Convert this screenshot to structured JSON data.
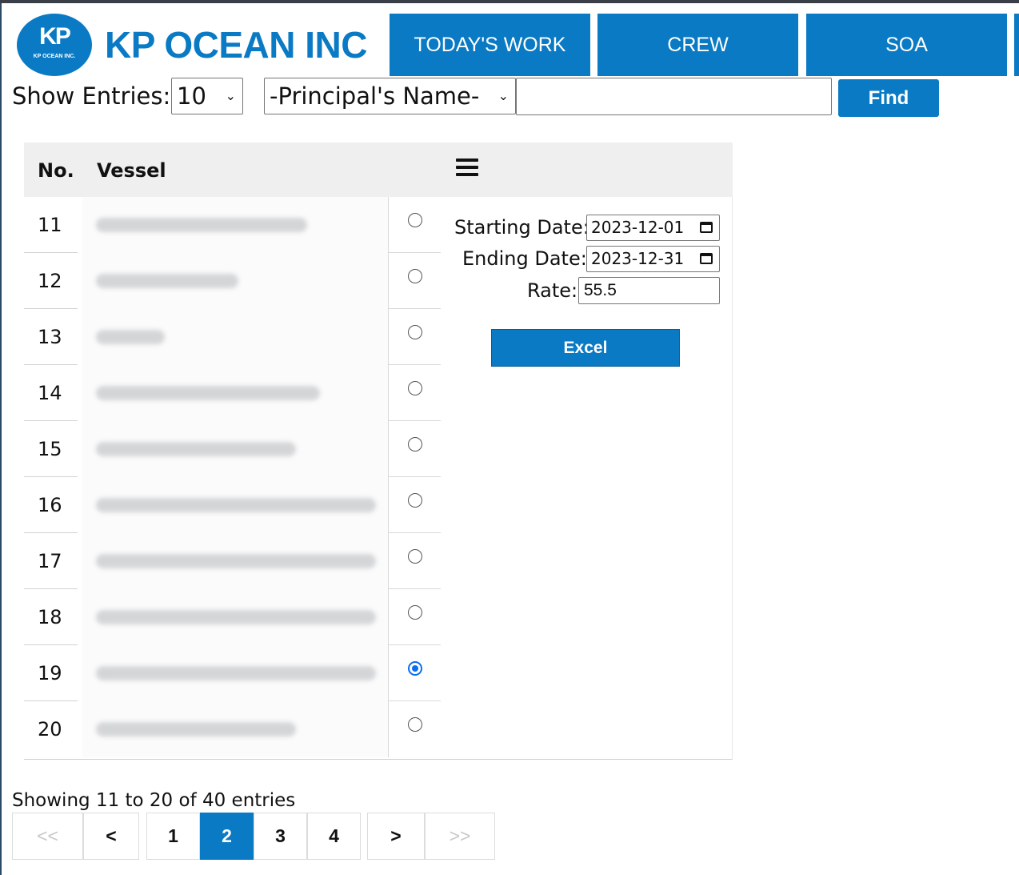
{
  "header": {
    "logo_mark": "KP",
    "logo_subtext": "KP OCEAN INC.",
    "brand": "KP OCEAN INC",
    "nav_tabs": [
      "TODAY'S WORK",
      "CREW",
      "SOA"
    ]
  },
  "filters": {
    "show_entries_label": "Show Entries:",
    "entries_value": "10",
    "principal_value": "-Principal's Name-",
    "search_value": "",
    "find_label": "Find"
  },
  "table": {
    "headers": {
      "no": "No.",
      "vessel": "Vessel"
    },
    "rows": [
      {
        "no": "11",
        "selected": false
      },
      {
        "no": "12",
        "selected": false
      },
      {
        "no": "13",
        "selected": false
      },
      {
        "no": "14",
        "selected": false
      },
      {
        "no": "15",
        "selected": false
      },
      {
        "no": "16",
        "selected": false
      },
      {
        "no": "17",
        "selected": false
      },
      {
        "no": "18",
        "selected": false
      },
      {
        "no": "19",
        "selected": true
      },
      {
        "no": "20",
        "selected": false
      }
    ]
  },
  "panel": {
    "starting_label": "Starting Date:",
    "starting_value": "2023-12-01",
    "ending_label": "Ending Date:",
    "ending_value": "2023-12-31",
    "rate_label": "Rate:",
    "rate_value": "55.5",
    "excel_label": "Excel"
  },
  "footer": {
    "showing_text": "Showing 11 to 20 of 40 entries",
    "pagination": {
      "first": "<<",
      "prev": "<",
      "pages": [
        "1",
        "2",
        "3",
        "4"
      ],
      "active_page": "2",
      "next": ">",
      "last": ">>"
    }
  },
  "colors": {
    "accent": "#0a7ac4",
    "radio_checked": "#0a6ff0"
  }
}
